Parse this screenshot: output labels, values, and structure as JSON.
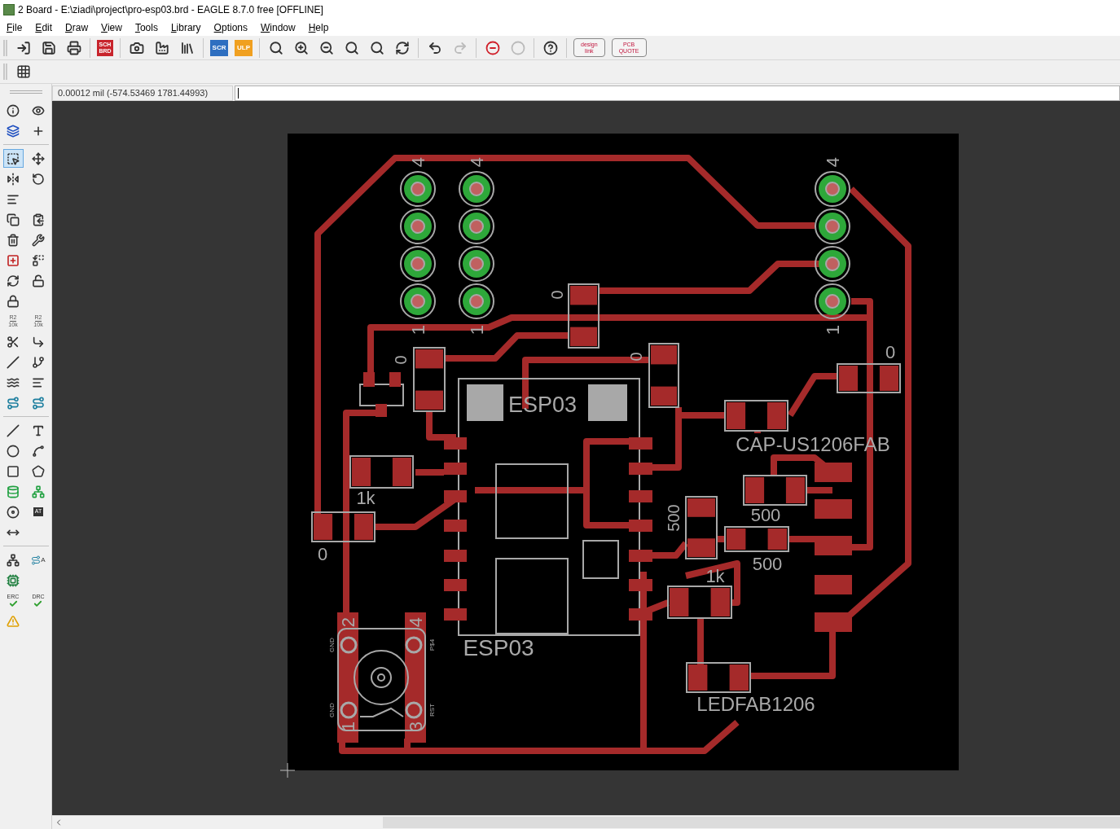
{
  "window": {
    "title": "2 Board - E:\\ziadi\\project\\pro-esp03.brd - EAGLE 8.7.0 free [OFFLINE]"
  },
  "menu": [
    "File",
    "Edit",
    "Draw",
    "View",
    "Tools",
    "Library",
    "Options",
    "Window",
    "Help"
  ],
  "toolbar": [
    {
      "kind": "open"
    },
    {
      "kind": "save"
    },
    {
      "kind": "print"
    },
    {
      "kind": "separator"
    },
    {
      "kind": "sch_brd",
      "lines": [
        "SCH",
        "BRD"
      ]
    },
    {
      "kind": "separator"
    },
    {
      "kind": "cam"
    },
    {
      "kind": "factory"
    },
    {
      "kind": "library"
    },
    {
      "kind": "separator"
    },
    {
      "kind": "scr",
      "label": "SCR"
    },
    {
      "kind": "ulp",
      "label": "ULP"
    },
    {
      "kind": "separator"
    },
    {
      "kind": "zoom_fit"
    },
    {
      "kind": "zoom_in"
    },
    {
      "kind": "zoom_out"
    },
    {
      "kind": "zoom_select"
    },
    {
      "kind": "zoom_menu"
    },
    {
      "kind": "redraw"
    },
    {
      "kind": "separator"
    },
    {
      "kind": "undo",
      "disabled": false
    },
    {
      "kind": "redo",
      "disabled": true
    },
    {
      "kind": "separator"
    },
    {
      "kind": "stop",
      "disabled": false
    },
    {
      "kind": "go",
      "disabled": true
    },
    {
      "kind": "separator"
    },
    {
      "kind": "help"
    },
    {
      "kind": "separator"
    },
    {
      "kind": "design_link",
      "lines": [
        "design",
        "link"
      ]
    },
    {
      "kind": "pcb_quote",
      "lines": [
        "PCB",
        "QUOTE"
      ]
    }
  ],
  "status": {
    "coordinates": "0.00012 mil (-574.53469 1781.44993)"
  },
  "tools": [
    [
      {
        "kind": "info",
        "selected": false
      },
      {
        "kind": "eye",
        "selected": false
      },
      {
        "kind": "layers",
        "selected": false
      },
      {
        "kind": "origin",
        "selected": false
      }
    ],
    [
      {
        "kind": "select",
        "selected": true
      },
      {
        "kind": "move",
        "selected": false
      },
      {
        "kind": "mirror",
        "selected": false
      },
      {
        "kind": "rotate",
        "selected": false
      },
      {
        "kind": "align",
        "selected": false
      },
      {
        "kind": "blank"
      },
      {
        "kind": "copy",
        "selected": false
      },
      {
        "kind": "paste",
        "selected": false
      },
      {
        "kind": "delete",
        "selected": false
      },
      {
        "kind": "wrench",
        "selected": false
      },
      {
        "kind": "add",
        "selected": false
      },
      {
        "kind": "replace",
        "selected": false
      },
      {
        "kind": "swap",
        "selected": false
      },
      {
        "kind": "lock_menu",
        "selected": false
      },
      {
        "kind": "lock",
        "selected": false
      },
      {
        "kind": "blank"
      },
      {
        "kind": "name",
        "lines": [
          "R2",
          "10k"
        ],
        "selected": false
      },
      {
        "kind": "value",
        "lines": [
          "R2",
          "10k"
        ],
        "selected": false
      },
      {
        "kind": "smash",
        "selected": false
      },
      {
        "kind": "miter",
        "selected": false
      },
      {
        "kind": "split",
        "selected": false
      },
      {
        "kind": "optimize",
        "selected": false
      },
      {
        "kind": "meander",
        "selected": false
      },
      {
        "kind": "pinswap",
        "selected": false
      },
      {
        "kind": "route",
        "selected": false
      },
      {
        "kind": "ripup",
        "selected": false
      }
    ],
    [
      {
        "kind": "line",
        "selected": false
      },
      {
        "kind": "text",
        "selected": false
      },
      {
        "kind": "circle",
        "selected": false
      },
      {
        "kind": "arc",
        "selected": false
      },
      {
        "kind": "rect",
        "selected": false
      },
      {
        "kind": "polygon",
        "selected": false
      },
      {
        "kind": "via",
        "selected": false
      },
      {
        "kind": "signal",
        "selected": false
      },
      {
        "kind": "hole",
        "selected": false
      },
      {
        "kind": "attribute",
        "label": "AT",
        "selected": false
      },
      {
        "kind": "dimension",
        "selected": false
      },
      {
        "kind": "blank"
      }
    ],
    [
      {
        "kind": "ratsnest",
        "selected": false
      },
      {
        "kind": "autorouter",
        "label": "A",
        "selected": false
      },
      {
        "kind": "chip",
        "selected": false
      },
      {
        "kind": "blank"
      },
      {
        "kind": "erc",
        "label": "ERC",
        "selected": false
      },
      {
        "kind": "drc",
        "label": "DRC",
        "selected": false
      },
      {
        "kind": "warning",
        "selected": false
      }
    ]
  ],
  "board": {
    "labels": [
      "4",
      "4",
      "4",
      "1",
      "1",
      "1",
      "0",
      "0",
      "0",
      "0",
      "ESP03",
      "CAP-US1206FAB",
      "1k",
      "500",
      "500",
      "0",
      "500",
      "1k",
      "ESP03",
      "LEDFAB1206",
      "2",
      "4",
      "1",
      "3",
      "GND",
      "P$4",
      "GND",
      "RST"
    ]
  }
}
